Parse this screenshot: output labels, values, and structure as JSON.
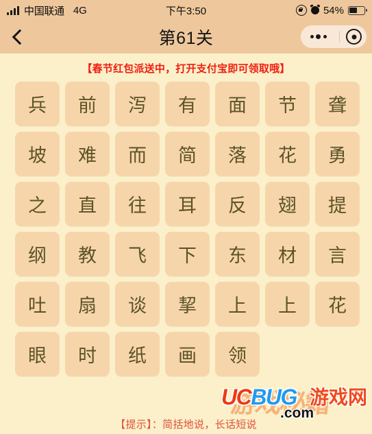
{
  "status_bar": {
    "carrier": "中国联通",
    "network": "4G",
    "time": "下午3:50",
    "battery_percent": "54%",
    "battery_level": 54,
    "icons": [
      "signal-bars-icon",
      "rotation-lock-icon",
      "alarm-clock-icon",
      "battery-icon"
    ]
  },
  "nav_bar": {
    "back_label": "",
    "title": "第61关",
    "capsule": {
      "menu_label": "",
      "target_label": ""
    }
  },
  "banner": {
    "text": "【春节红包派送中，打开支付宝即可领取哦】",
    "color": "#ef1f10"
  },
  "grid": {
    "tile_color": "#f7d5ab",
    "text_color": "#5c5327",
    "rows": [
      [
        "兵",
        "前",
        "泻",
        "有",
        "面",
        "节",
        "聋"
      ],
      [
        "坡",
        "难",
        "而",
        "简",
        "落",
        "花",
        "勇"
      ],
      [
        "之",
        "直",
        "往",
        "耳",
        "反",
        "翅",
        "提"
      ],
      [
        "纲",
        "教",
        "飞",
        "下",
        "东",
        "材",
        "言"
      ],
      [
        "吐",
        "扇",
        "谈",
        "挈",
        "上",
        "上",
        "花"
      ],
      [
        "眼",
        "时",
        "纸",
        "画",
        "领"
      ]
    ]
  },
  "hint": {
    "text": "【提示】：简括地说，长话短说",
    "color": "#e0503a"
  },
  "watermark": {
    "uc": "UC",
    "bug": "BUG",
    "cn": "游戏网",
    "com": ".com",
    "ghost": "游戏秘籍"
  },
  "theme": {
    "page_background": "#fbf0ca",
    "bar_background": "#eec89c",
    "capsule_background": "#f9e8d8"
  }
}
